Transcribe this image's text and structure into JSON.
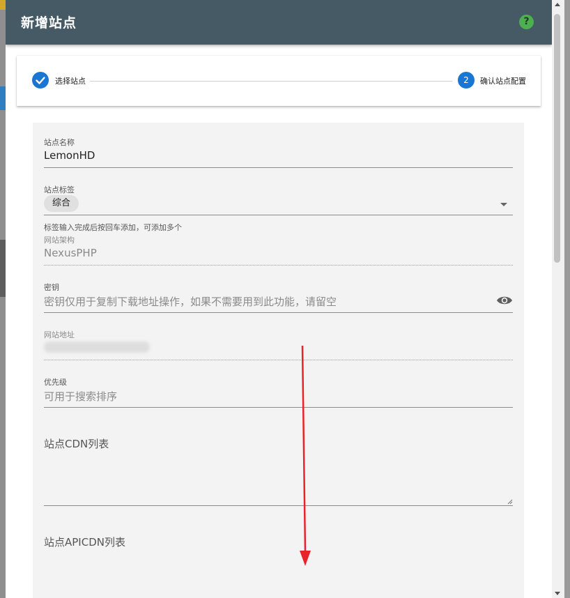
{
  "dialog": {
    "title": "新增站点",
    "help_icon": "question-circle-icon",
    "help_glyph": "?"
  },
  "stepper": {
    "steps": [
      {
        "label": "选择站点",
        "state": "completed",
        "icon": "check-icon"
      },
      {
        "label": "确认站点配置",
        "state": "active",
        "number": "2"
      }
    ]
  },
  "form": {
    "site_name": {
      "label": "站点名称",
      "value": "LemonHD"
    },
    "site_tags": {
      "label": "站点标签",
      "chips": [
        "综合"
      ],
      "hint": "标签输入完成后按回车添加，可添加多个"
    },
    "framework": {
      "label": "网站架构",
      "value": "NexusPHP"
    },
    "secret_key": {
      "label": "密钥",
      "placeholder": "密钥仅用于复制下载地址操作，如果不需要用到此功能，请留空",
      "icon": "eye-icon"
    },
    "site_url": {
      "label": "网站地址"
    },
    "priority": {
      "label": "优先级",
      "placeholder": "可用于搜索排序"
    },
    "cdn_list": {
      "label": "站点CDN列表"
    },
    "api_cdn_list": {
      "label": "站点APICDN列表"
    }
  },
  "colors": {
    "header": "#455a64",
    "accent": "#1976d2",
    "help": "#4caf50",
    "annotation_arrow": "#e8232a"
  }
}
